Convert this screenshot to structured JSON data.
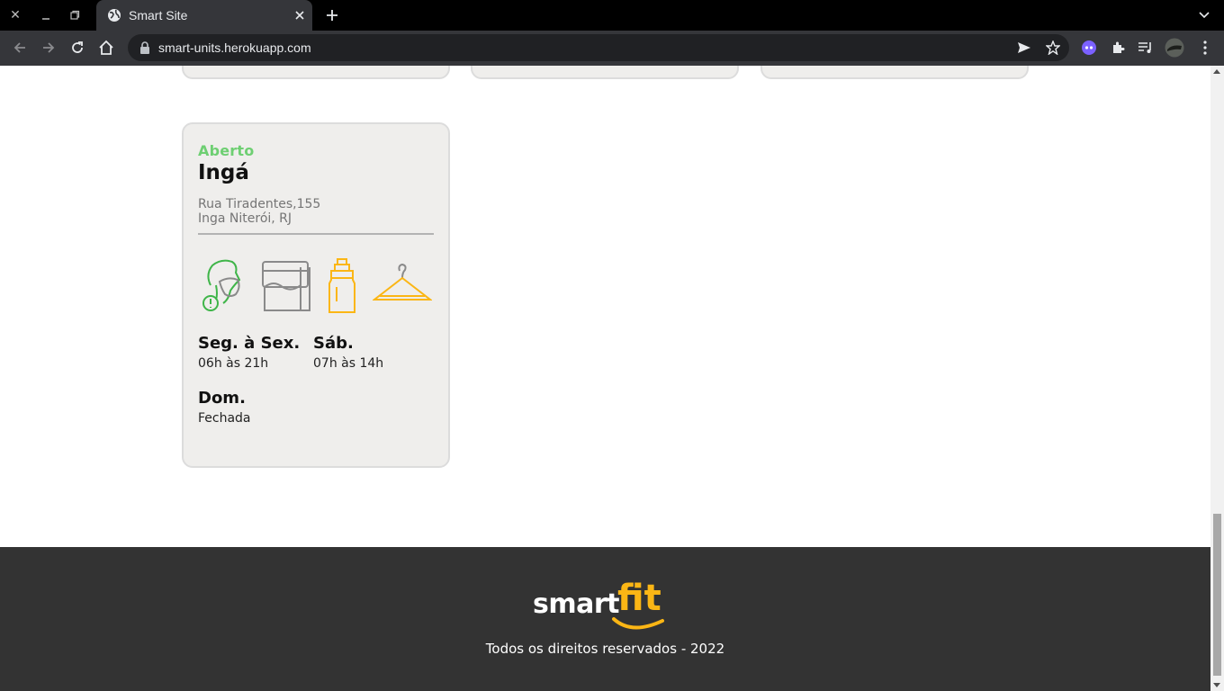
{
  "browser": {
    "tab_title": "Smart Site",
    "url": "smart-units.herokuapp.com"
  },
  "unit": {
    "status": "Aberto",
    "name": "Ingá",
    "address_line1": "Rua Tiradentes,155",
    "address_line2": "Inga Niterói, RJ",
    "amenity_icons": [
      "mask-required-icon",
      "towel-required-icon",
      "bottle-required-icon",
      "locker-room-icon"
    ],
    "schedule": [
      {
        "days": "Seg. à Sex.",
        "hours": "06h às 21h"
      },
      {
        "days": "Sáb.",
        "hours": "07h às 14h"
      },
      {
        "days": "Dom.",
        "hours": "Fechada"
      }
    ]
  },
  "footer": {
    "logo_smart": "smart",
    "logo_fit": "fit",
    "copyright": "Todos os direitos reservados - 2022"
  },
  "colors": {
    "status_open": "#6ecf72",
    "brand_yellow": "#fbb615",
    "footer_bg": "#333333",
    "card_bg": "#efeeec"
  }
}
